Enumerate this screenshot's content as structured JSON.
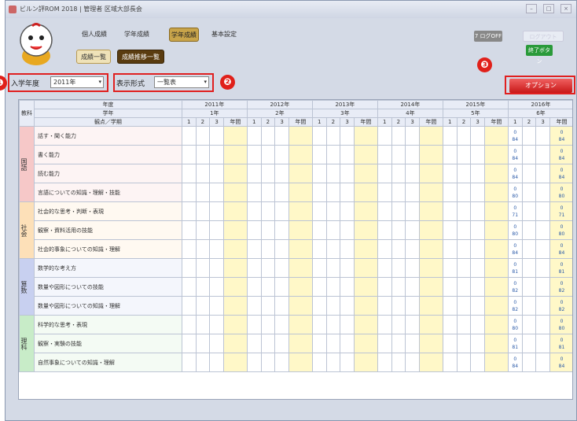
{
  "window": {
    "title": "ビルン評ROM 2018 | 管理者 区域大部長会"
  },
  "header": {
    "nav_tabs": [
      "個人成績",
      "学年成績",
      "学年成績",
      "基本設定"
    ],
    "sub_tabs": [
      "成績一覧",
      "成績推移一覧"
    ],
    "btn_top1": "7 ログOFF",
    "btn_top2": "ログアウト",
    "btn_green": "終了ボタン"
  },
  "controls": {
    "year_label": "入学年度",
    "year_value": "2011年",
    "display_label": "表示形式",
    "display_value": "一覧表",
    "option_label": "オプション",
    "badge1": "❶",
    "badge2": "❷",
    "badge3": "❸"
  },
  "grid": {
    "corner_label": "教科",
    "hdr_nendo": "年度",
    "hdr_gakunen": "学年",
    "hdr_kanten": "観点／学期",
    "years": [
      "2011年",
      "2012年",
      "2013年",
      "2014年",
      "2015年",
      "2016年"
    ],
    "grades": [
      "1年",
      "2年",
      "3年",
      "4年",
      "5年",
      "6年"
    ],
    "terms": [
      "1",
      "2",
      "3",
      "年間"
    ],
    "subjects": [
      {
        "name": "国語",
        "color": "#f6c8c8",
        "rows": [
          "話す・聞く能力",
          "書く能力",
          "読む能力",
          "言語についての知識・理解・技能"
        ],
        "vals": [
          "84",
          "84",
          "84",
          "80"
        ]
      },
      {
        "name": "社会",
        "color": "#fde0b8",
        "rows": [
          "社会的な思考・判断・表現",
          "観察・資料活用の技能",
          "社会的事象についての知識・理解"
        ],
        "vals": [
          "71",
          "80",
          "84"
        ]
      },
      {
        "name": "算数",
        "color": "#c8d0f0",
        "rows": [
          "数学的な考え方",
          "数量や図形についての技能",
          "数量や図形についての知識・理解"
        ],
        "vals": [
          "81",
          "82",
          "82"
        ]
      },
      {
        "name": "理科",
        "color": "#c8ecc8",
        "rows": [
          "科学的な思考・表現",
          "観察・実験の技能",
          "自然事象についての知識・理解"
        ],
        "vals": [
          "80",
          "81",
          "84"
        ]
      }
    ]
  }
}
